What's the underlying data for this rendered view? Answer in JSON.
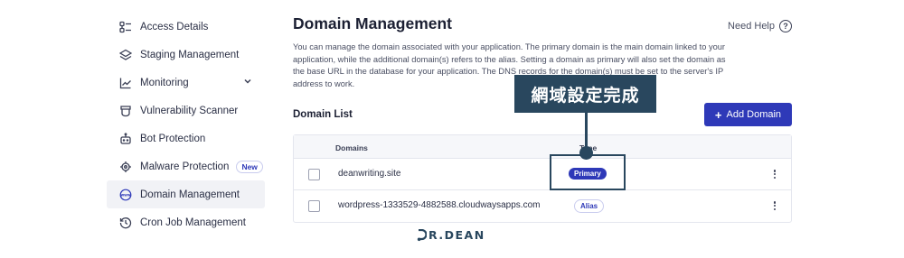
{
  "sidebar": {
    "items": [
      {
        "label": "Access Details",
        "icon": "access-details-icon"
      },
      {
        "label": "Staging Management",
        "icon": "layers-icon"
      },
      {
        "label": "Monitoring",
        "icon": "chart-icon",
        "has_chevron": true
      },
      {
        "label": "Vulnerability Scanner",
        "icon": "scanner-icon"
      },
      {
        "label": "Bot Protection",
        "icon": "bot-icon"
      },
      {
        "label": "Malware Protection",
        "icon": "malware-icon",
        "badge": "New"
      },
      {
        "label": "Domain Management",
        "icon": "www-icon",
        "active": true
      },
      {
        "label": "Cron Job Management",
        "icon": "history-icon"
      }
    ]
  },
  "main": {
    "title": "Domain Management",
    "need_help": "Need Help",
    "description": "You can manage the domain associated with your application. The primary domain is the main domain linked to your application, while the additional domain(s) refers to the alias. Setting a domain as primary will also set the domain as the base URL in the database for your application. The DNS records for the domain(s) must be set to the server's IP address to work.",
    "list_title": "Domain List",
    "add_button": "Add Domain",
    "table": {
      "columns": [
        "Domains",
        "Type"
      ],
      "rows": [
        {
          "domain": "deanwriting.site",
          "type": "Primary"
        },
        {
          "domain": "wordpress-1333529-4882588.cloudwaysapps.com",
          "type": "Alias"
        }
      ]
    }
  },
  "annotation": {
    "text": "網域設定完成"
  },
  "watermark": {
    "text": "R.DEAN"
  },
  "colors": {
    "accent": "#2e39b8",
    "annotation": "#29475e"
  }
}
